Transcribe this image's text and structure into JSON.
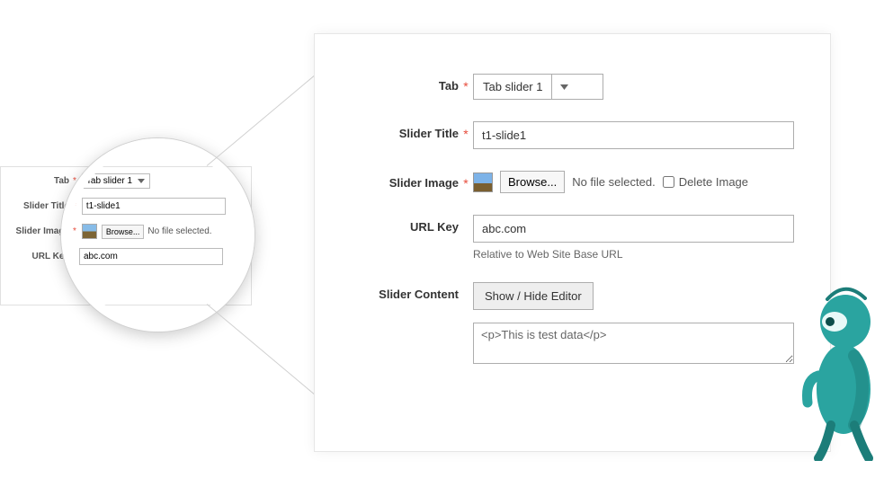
{
  "form": {
    "tab": {
      "label": "Tab",
      "value": "Tab slider 1"
    },
    "sliderTitle": {
      "label": "Slider Title",
      "value": "t1-slide1"
    },
    "sliderImage": {
      "label": "Slider Image",
      "browse": "Browse...",
      "noFile": "No file selected.",
      "deleteLabel": "Delete Image"
    },
    "urlKey": {
      "label": "URL Key",
      "value": "abc.com",
      "hint": "Relative to Web Site Base URL"
    },
    "sliderContent": {
      "label": "Slider Content",
      "toggleButton": "Show / Hide Editor",
      "value": "<p>This is test data</p>"
    }
  }
}
